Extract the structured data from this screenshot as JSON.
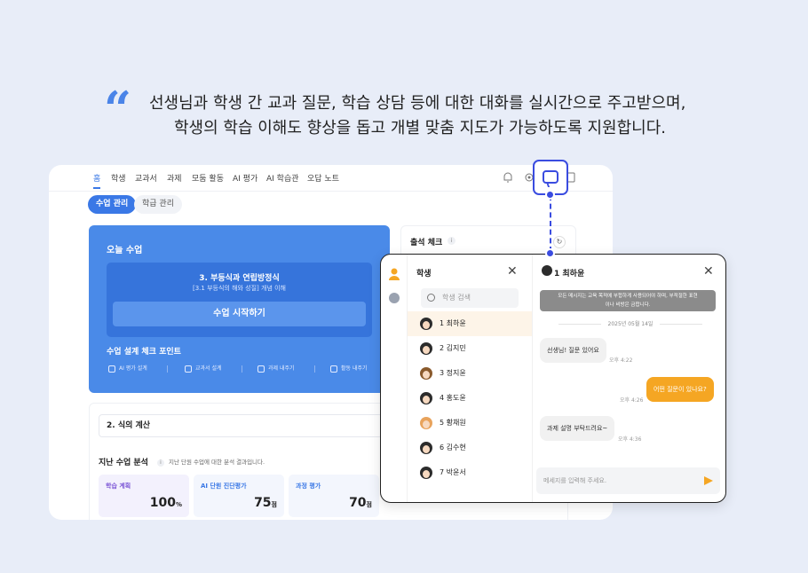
{
  "headline": {
    "quote_mark": "“",
    "line1": "선생님과 학생 간 교과 질문, 학습 상담 등에 대한 대화를 실시간으로 주고받으며,",
    "line2": "학생의 학습 이해도 향상을 돕고 개별 맞춤 지도가 가능하도록 지원합니다."
  },
  "nav": {
    "items": [
      "홈",
      "학생",
      "교과서",
      "과제",
      "모둠 활동",
      "AI 평가",
      "AI 학습관",
      "오답 노트"
    ],
    "active": "홈"
  },
  "subtabs": [
    "수업 관리",
    "학급 관리"
  ],
  "today": {
    "title": "오늘 수업",
    "lesson_name": "3. 부등식과 연립방정식",
    "lesson_sub": "[3.1 부등식의 해와 성질] 개념 이해",
    "start_button": "수업 시작하기",
    "check_title": "수업 설계 체크 포인트",
    "chips": [
      "AI 평가 설계",
      "교과서 설계",
      "과제 내주기",
      "활동 내주기"
    ]
  },
  "attendance": {
    "title": "출석 체크",
    "info": "i"
  },
  "lower": {
    "topic": "2. 식의 계산",
    "prev_title": "지난 수업 분석",
    "prev_desc": "지난 단원 수업에 대한 분석 결과입니다.",
    "scores": [
      {
        "label": "학습 계획",
        "value": "100",
        "unit": "%"
      },
      {
        "label": "AI 단원 진단평가",
        "value": "75",
        "unit": "점"
      },
      {
        "label": "과정 평가",
        "value": "70",
        "unit": "점"
      }
    ]
  },
  "student_panel": {
    "title": "학생",
    "close": "✕",
    "search_placeholder": "학생 검색",
    "students": [
      "1 최하윤",
      "2 김지민",
      "3 정지윤",
      "4 홍도윤",
      "5 황채원",
      "6 김수현",
      "7 박윤서"
    ],
    "selected_index": 0
  },
  "chat": {
    "contact": "1 최하윤",
    "close": "✕",
    "notice_line1": "모든 메시지는 교육 목적에 부합하게 사용되어야 하며, 부적절한 표현",
    "notice_line2": "이나 비방은 금합니다.",
    "date": "2025년 05월 14일",
    "messages": [
      {
        "dir": "in",
        "text": "선생님! 질문 있어요",
        "time": "오후 4:22"
      },
      {
        "dir": "out",
        "text": "어떤 질문이 있나요?",
        "time": "오후 4:26"
      },
      {
        "dir": "in",
        "text": "과제 설명 부탁드려요~",
        "time": "오후 4:36"
      }
    ],
    "input_placeholder": "메세지를 입력해 주세요."
  },
  "colors": {
    "accent": "#3a78e6",
    "highlight": "#3a4ce0",
    "outgoing": "#f5a623",
    "background": "#e8edf8"
  }
}
